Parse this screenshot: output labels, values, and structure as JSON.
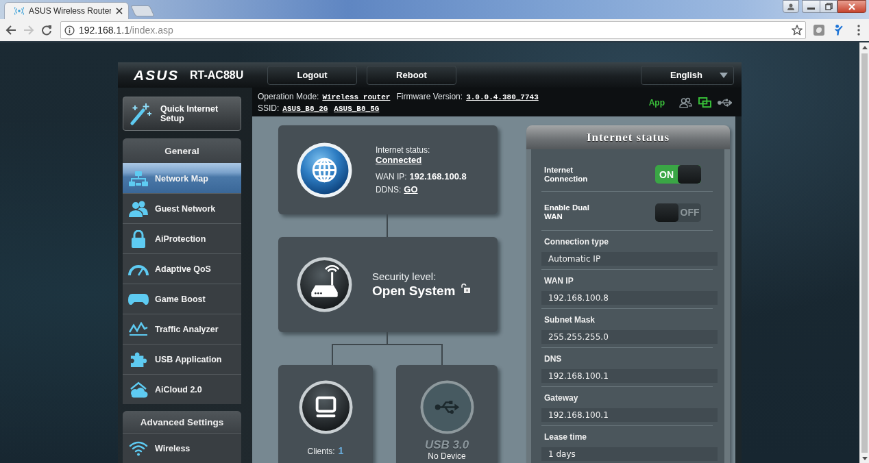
{
  "browser": {
    "tab": {
      "title": "ASUS Wireless Router"
    },
    "url": {
      "host": "192.168.1.1",
      "path": "/index.asp"
    },
    "forward_button": {
      "disabled": true
    }
  },
  "header": {
    "logo": "ASUS",
    "model": "RT-AC88U",
    "buttons": [
      "Logout",
      "Reboot"
    ],
    "language": "English"
  },
  "info_bar": {
    "operation_mode": {
      "label": "Operation Mode:",
      "value": "Wireless router"
    },
    "firmware": {
      "label": "Firmware Version:",
      "value": "3.0.0.4.380_7743"
    },
    "ssid": {
      "label": "SSID:",
      "values": [
        "ASUS_B8_2G",
        "ASUS_B8_5G"
      ]
    },
    "app_label": "App",
    "status_icons": [
      {
        "kind": "clients",
        "active": false
      },
      {
        "kind": "network",
        "active": true
      },
      {
        "kind": "usb",
        "active": false
      }
    ]
  },
  "quick_setup": {
    "label": "Quick Internet Setup"
  },
  "sidebar": {
    "sections": [
      {
        "title": "General",
        "items": [
          {
            "label": "Network Map",
            "kind": "network-map",
            "selected": true
          },
          {
            "label": "Guest Network",
            "kind": "guest-network",
            "selected": false
          },
          {
            "label": "AiProtection",
            "kind": "protection",
            "selected": false
          },
          {
            "label": "Adaptive QoS",
            "kind": "qos",
            "selected": false
          },
          {
            "label": "Game Boost",
            "kind": "game",
            "selected": false
          },
          {
            "label": "Traffic Analyzer",
            "kind": "traffic",
            "selected": false
          },
          {
            "label": "USB Application",
            "kind": "usb-app",
            "selected": false
          },
          {
            "label": "AiCloud 2.0",
            "kind": "cloud",
            "selected": false
          }
        ]
      },
      {
        "title": "Advanced Settings",
        "items": [
          {
            "label": "Wireless",
            "kind": "wireless",
            "selected": false
          }
        ]
      }
    ]
  },
  "network_map": {
    "internet": {
      "status_label": "Internet status:",
      "status": "Connected",
      "wan_ip_label": "WAN IP:",
      "wan_ip": "192.168.100.8",
      "ddns_label": "DDNS:",
      "ddns": "GO"
    },
    "router": {
      "security_label": "Security level:",
      "security": "Open System"
    },
    "clients": {
      "label": "Clients:",
      "count": "1"
    },
    "usb": {
      "label": "USB 3.0",
      "status": "No Device"
    }
  },
  "internet_status": {
    "title": "Internet status",
    "toggles": [
      {
        "label": "Internet Connection",
        "text": "ON",
        "on": true
      },
      {
        "label": "Enable Dual WAN",
        "text": "OFF",
        "on": false
      }
    ],
    "fields": [
      {
        "label": "Connection type",
        "value": "Automatic IP"
      },
      {
        "label": "WAN IP",
        "value": "192.168.100.8"
      },
      {
        "label": "Subnet Mask",
        "value": "255.255.255.0"
      },
      {
        "label": "DNS",
        "value": "192.168.100.1"
      },
      {
        "label": "Gateway",
        "value": "192.168.100.1"
      },
      {
        "label": "Lease time",
        "value": "1 days"
      }
    ]
  }
}
